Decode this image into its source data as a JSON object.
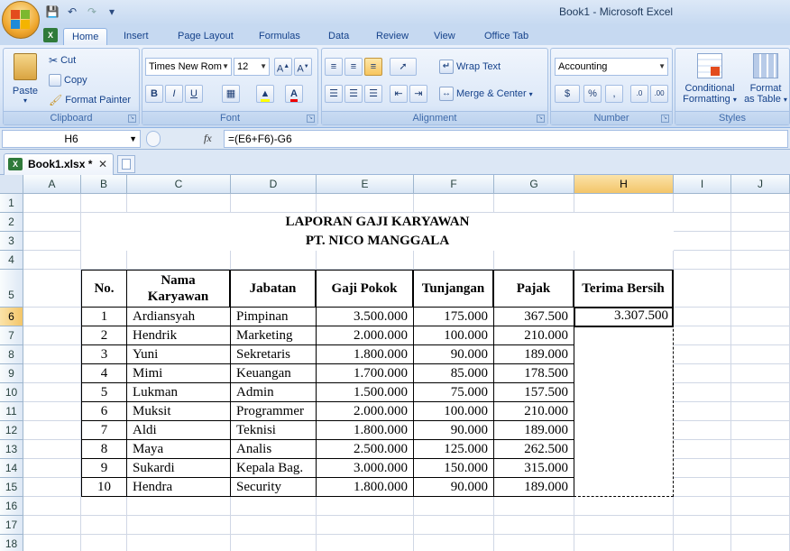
{
  "window": {
    "title": "Book1 - Microsoft Excel"
  },
  "ribbon_tabs": [
    "Home",
    "Insert",
    "Page Layout",
    "Formulas",
    "Data",
    "Review",
    "View",
    "Office Tab"
  ],
  "clipboard": {
    "paste": "Paste",
    "cut": "Cut",
    "copy": "Copy",
    "format_painter": "Format Painter",
    "label": "Clipboard"
  },
  "font": {
    "name": "Times New Rom",
    "size": "12",
    "label": "Font"
  },
  "alignment": {
    "wrap_text": "Wrap Text",
    "merge_center": "Merge & Center",
    "label": "Alignment"
  },
  "number": {
    "format": "Accounting",
    "label": "Number"
  },
  "styles": {
    "conditional": "Conditional",
    "formatting": "Formatting",
    "format_as": "Format",
    "as_table": "as Table",
    "label": "Styles"
  },
  "formula_bar": {
    "name_box": "H6",
    "fx": "fx",
    "formula": "=(E6+F6)-G6"
  },
  "doc_tab": {
    "name": "Book1.xlsx *"
  },
  "columns": [
    "A",
    "B",
    "C",
    "D",
    "E",
    "F",
    "G",
    "H",
    "I",
    "J"
  ],
  "rows": [
    "1",
    "2",
    "3",
    "4",
    "5",
    "6",
    "7",
    "8",
    "9",
    "10",
    "11",
    "12",
    "13",
    "14",
    "15",
    "16",
    "17",
    "18"
  ],
  "sheet": {
    "title1": "LAPORAN GAJI KARYAWAN",
    "title2": "PT. NICO MANGGALA",
    "headers": [
      "No.",
      "Nama Karyawan",
      "Jabatan",
      "Gaji Pokok",
      "Tunjangan",
      "Pajak",
      "Terima Bersih"
    ],
    "data": [
      [
        "1",
        "Ardiansyah",
        "Pimpinan",
        "3.500.000",
        "175.000",
        "367.500",
        "3.307.500"
      ],
      [
        "2",
        "Hendrik",
        "Marketing",
        "2.000.000",
        "100.000",
        "210.000",
        ""
      ],
      [
        "3",
        "Yuni",
        "Sekretaris",
        "1.800.000",
        "90.000",
        "189.000",
        ""
      ],
      [
        "4",
        "Mimi",
        "Keuangan",
        "1.700.000",
        "85.000",
        "178.500",
        ""
      ],
      [
        "5",
        "Lukman",
        "Admin",
        "1.500.000",
        "75.000",
        "157.500",
        ""
      ],
      [
        "6",
        "Muksit",
        "Programmer",
        "2.000.000",
        "100.000",
        "210.000",
        ""
      ],
      [
        "7",
        "Aldi",
        "Teknisi",
        "1.800.000",
        "90.000",
        "189.000",
        ""
      ],
      [
        "8",
        "Maya",
        "Analis",
        "2.500.000",
        "125.000",
        "262.500",
        ""
      ],
      [
        "9",
        "Sukardi",
        "Kepala Bag.",
        "3.000.000",
        "150.000",
        "315.000",
        ""
      ],
      [
        "10",
        "Hendra",
        "Security",
        "1.800.000",
        "90.000",
        "189.000",
        ""
      ]
    ]
  }
}
